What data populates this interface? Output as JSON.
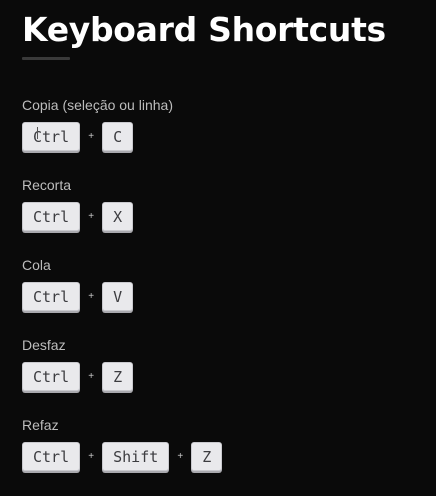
{
  "page": {
    "title": "Keyboard Shortcuts"
  },
  "shortcuts": [
    {
      "label": "Copia (seleção ou linha)",
      "keys": [
        "Ctrl",
        "C"
      ]
    },
    {
      "label": "Recorta",
      "keys": [
        "Ctrl",
        "X"
      ]
    },
    {
      "label": "Cola",
      "keys": [
        "Ctrl",
        "V"
      ]
    },
    {
      "label": "Desfaz",
      "keys": [
        "Ctrl",
        "Z"
      ]
    },
    {
      "label": "Refaz",
      "keys": [
        "Ctrl",
        "Shift",
        "Z"
      ]
    }
  ],
  "separator": "+",
  "colors": {
    "background": "#0a0a0a",
    "title": "#ffffff",
    "label": "#bdbdbd",
    "key_face": "#e9e9ec",
    "key_text": "#3c3c40"
  }
}
